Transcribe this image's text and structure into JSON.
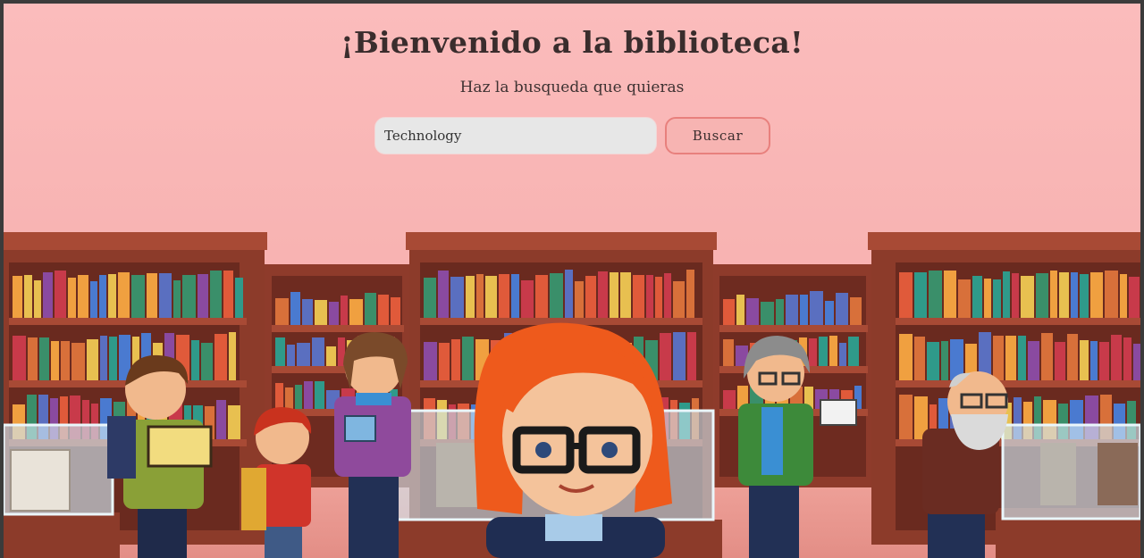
{
  "header": {
    "title": "¡Bienvenido a la biblioteca!",
    "subtitle": "Haz la busqueda que quieras"
  },
  "search": {
    "value": "Technology",
    "button_label": "Buscar"
  },
  "colors": {
    "background": "#fbbcbc",
    "input_bg": "#e7e7e7",
    "button_bg": "#f7b4b2",
    "button_border": "#e8807d",
    "title_text": "#3a2d2d"
  },
  "illustration": {
    "name": "pixel-art-library-scene"
  }
}
